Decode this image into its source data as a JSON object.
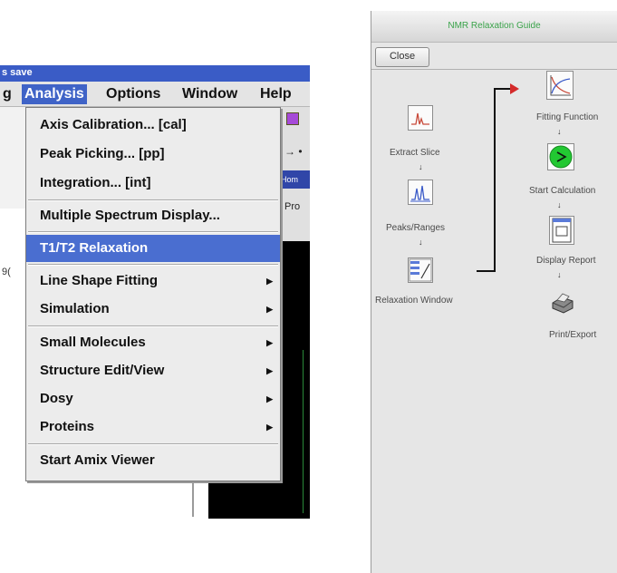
{
  "left_window": {
    "title_fragment": "s save",
    "left_fragment": "g",
    "menu": {
      "analysis": "Analysis",
      "options": "Options",
      "window": "Window",
      "help": "Help"
    },
    "partial_right_text": "Pro",
    "partial_left_number": "9(",
    "dropdown_items": [
      {
        "label": "Axis Calibration... [cal]",
        "submenu": false,
        "selected": false
      },
      {
        "label": "Peak Picking... [pp]",
        "submenu": false,
        "selected": false
      },
      {
        "label": "Integration... [int]",
        "submenu": false,
        "selected": false
      },
      {
        "label": "Multiple Spectrum Display...",
        "submenu": false,
        "selected": false
      },
      {
        "label": "T1/T2 Relaxation",
        "submenu": false,
        "selected": true
      },
      {
        "label": "Line Shape Fitting",
        "submenu": true,
        "selected": false
      },
      {
        "label": "Simulation",
        "submenu": true,
        "selected": false
      },
      {
        "label": "Small Molecules",
        "submenu": true,
        "selected": false
      },
      {
        "label": "Structure Edit/View",
        "submenu": true,
        "selected": false
      },
      {
        "label": "Dosy",
        "submenu": true,
        "selected": false
      },
      {
        "label": "Proteins",
        "submenu": true,
        "selected": false
      },
      {
        "label": "Start Amix Viewer",
        "submenu": false,
        "selected": false
      }
    ]
  },
  "guide": {
    "title": "NMR Relaxation Guide",
    "close_button": "Close",
    "steps_left": [
      {
        "label": "Extract Slice",
        "icon": "extract-slice-icon"
      },
      {
        "label": "Peaks/Ranges",
        "icon": "peaks-ranges-icon"
      },
      {
        "label": "Relaxation Window",
        "icon": "relaxation-window-icon"
      }
    ],
    "steps_right": [
      {
        "label": "Fitting Function",
        "icon": "fitting-function-icon"
      },
      {
        "label": "Start Calculation",
        "icon": "start-calculation-icon"
      },
      {
        "label": "Display Report",
        "icon": "display-report-icon"
      },
      {
        "label": "Print/Export",
        "icon": "print-export-icon"
      }
    ],
    "colors": {
      "title_text": "#3aa34a",
      "connector_arrow": "#d42a2a",
      "start_button": "#22c832"
    }
  }
}
